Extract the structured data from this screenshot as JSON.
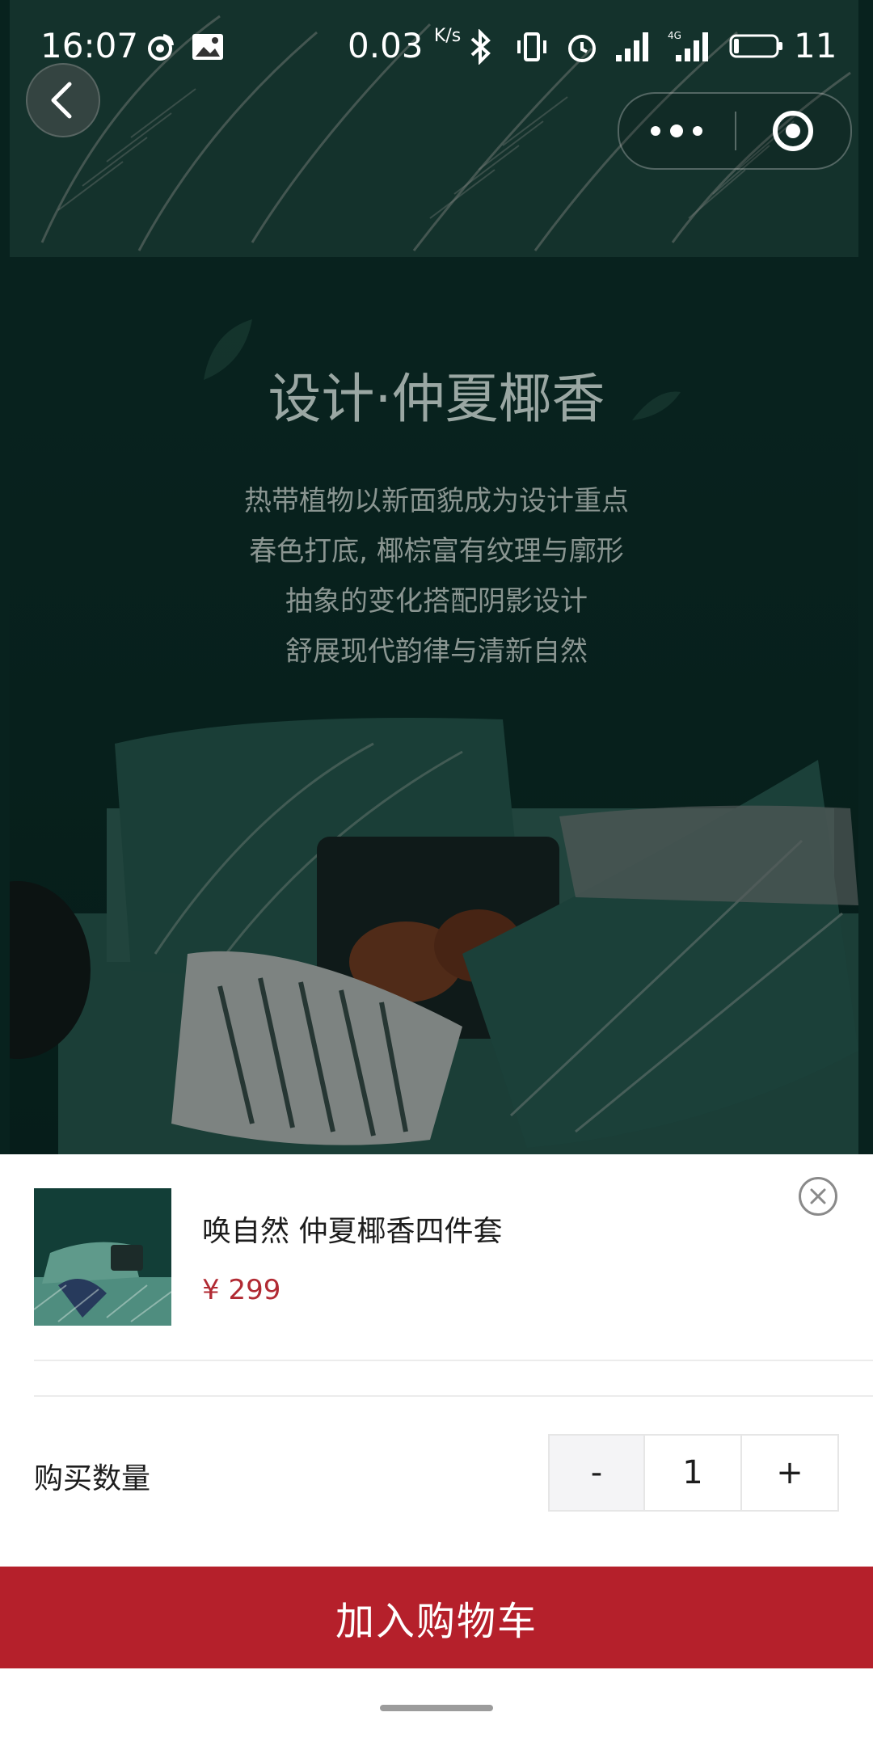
{
  "status_bar": {
    "time": "16:07",
    "net_speed": "0.03",
    "net_speed_unit": "K/s",
    "battery_level": "11"
  },
  "hero": {
    "title": "设计·仲夏椰香",
    "lines": [
      "热带植物以新面貌成为设计重点",
      "春色打底, 椰棕富有纹理与廓形",
      "抽象的变化搭配阴影设计",
      "舒展现代韵律与清新自然"
    ]
  },
  "product": {
    "name": "唤自然 仲夏椰香四件套",
    "price": "¥ 299"
  },
  "quantity": {
    "label": "购买数量",
    "minus": "-",
    "value": "1",
    "plus": "+"
  },
  "actions": {
    "add_to_cart": "加入购物车"
  },
  "icons": {
    "back": "chevron-left-icon",
    "more": "more-dots-icon",
    "close_miniprogram": "target-icon",
    "close_sheet": "close-circle-icon"
  },
  "colors": {
    "accent": "#b5202b",
    "price": "#b12a33",
    "hero_bg": "#0f3b35"
  }
}
